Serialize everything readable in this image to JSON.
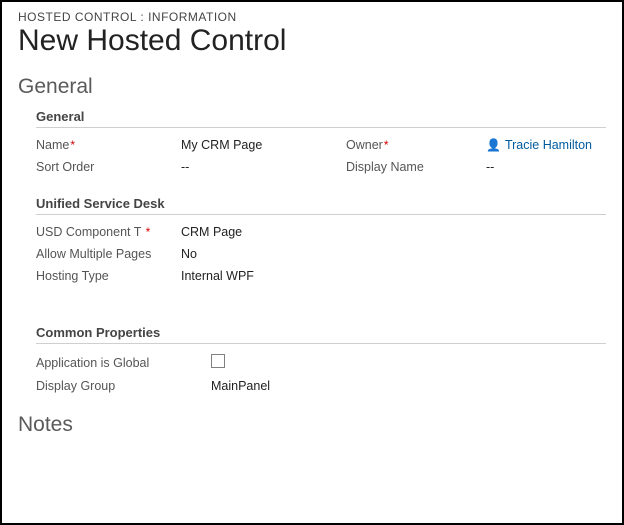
{
  "header": {
    "eyebrow": "HOSTED CONTROL : INFORMATION",
    "title": "New Hosted Control"
  },
  "sections": {
    "general_title": "General",
    "general_sub": "General",
    "usd_sub": "Unified Service Desk",
    "common_sub": "Common Properties",
    "notes_title": "Notes"
  },
  "labels": {
    "name": "Name",
    "owner": "Owner",
    "sort_order": "Sort Order",
    "display_name": "Display Name",
    "usd_component_type": "USD Component T",
    "allow_multiple_pages": "Allow Multiple Pages",
    "hosting_type": "Hosting Type",
    "app_is_global": "Application is Global",
    "display_group": "Display Group"
  },
  "values": {
    "name": "My CRM Page",
    "owner": "Tracie Hamilton",
    "sort_order": "--",
    "display_name": "--",
    "usd_component_type": "CRM Page",
    "allow_multiple_pages": "No",
    "hosting_type": "Internal WPF",
    "display_group": "MainPanel"
  },
  "icons": {
    "user_glyph": "👤"
  }
}
